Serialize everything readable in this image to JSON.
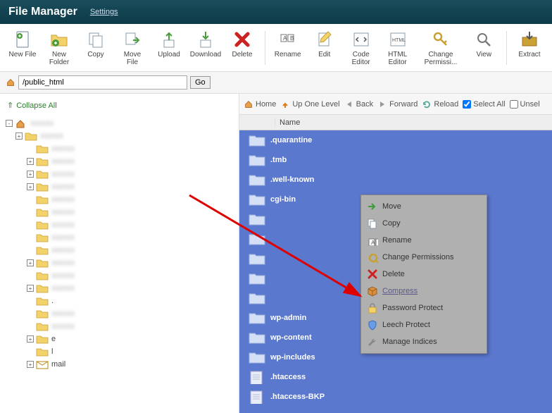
{
  "header": {
    "title": "File Manager",
    "settings": "Settings"
  },
  "toolbar": [
    {
      "key": "new-file",
      "label": "New File"
    },
    {
      "key": "new-folder",
      "label": "New Folder"
    },
    {
      "key": "copy",
      "label": "Copy"
    },
    {
      "key": "move-file",
      "label": "Move File"
    },
    {
      "key": "upload",
      "label": "Upload"
    },
    {
      "key": "download",
      "label": "Download"
    },
    {
      "key": "delete",
      "label": "Delete"
    },
    {
      "key": "sep",
      "label": ""
    },
    {
      "key": "rename",
      "label": "Rename"
    },
    {
      "key": "edit",
      "label": "Edit"
    },
    {
      "key": "code-editor",
      "label": "Code Editor"
    },
    {
      "key": "html-editor",
      "label": "HTML Editor"
    },
    {
      "key": "change-perms",
      "label": "Change Permissi..."
    },
    {
      "key": "view",
      "label": "View"
    },
    {
      "key": "sep",
      "label": ""
    },
    {
      "key": "extract",
      "label": "Extract"
    }
  ],
  "pathbar": {
    "path": "/public_html",
    "go": "Go"
  },
  "collapse_all": "Collapse All",
  "tree": [
    {
      "indent": 0,
      "toggle": "-",
      "label": "",
      "blur": true,
      "home": true
    },
    {
      "indent": 1,
      "toggle": "+",
      "label": "",
      "blur": true
    },
    {
      "indent": 2,
      "toggle": "",
      "label": "",
      "blur": true
    },
    {
      "indent": 2,
      "toggle": "+",
      "label": "",
      "blur": true
    },
    {
      "indent": 2,
      "toggle": "+",
      "label": "",
      "blur": true
    },
    {
      "indent": 2,
      "toggle": "+",
      "label": "",
      "blur": true
    },
    {
      "indent": 2,
      "toggle": "",
      "label": "",
      "blur": true
    },
    {
      "indent": 2,
      "toggle": "",
      "label": "",
      "blur": true
    },
    {
      "indent": 2,
      "toggle": "",
      "label": "",
      "blur": true
    },
    {
      "indent": 2,
      "toggle": "",
      "label": "",
      "blur": true
    },
    {
      "indent": 2,
      "toggle": "",
      "label": "",
      "blur": true
    },
    {
      "indent": 2,
      "toggle": "+",
      "label": "",
      "blur": true
    },
    {
      "indent": 2,
      "toggle": "",
      "label": "",
      "blur": true
    },
    {
      "indent": 2,
      "toggle": "+",
      "label": "",
      "blur": true
    },
    {
      "indent": 2,
      "toggle": "",
      "label": ".",
      "blur": false
    },
    {
      "indent": 2,
      "toggle": "",
      "label": "",
      "blur": true
    },
    {
      "indent": 2,
      "toggle": "",
      "label": "",
      "blur": true
    },
    {
      "indent": 2,
      "toggle": "+",
      "label": "e",
      "blur": false
    },
    {
      "indent": 2,
      "toggle": "",
      "label": "l",
      "blur": false
    },
    {
      "indent": 2,
      "toggle": "+",
      "label": "mail",
      "blur": false,
      "mail": true
    }
  ],
  "nav2": {
    "home": "Home",
    "up": "Up One Level",
    "back": "Back",
    "forward": "Forward",
    "reload": "Reload",
    "select_all": "Select All",
    "unselect": "Unsel"
  },
  "list_header": {
    "name": "Name"
  },
  "files": [
    {
      "name": ".quarantine",
      "type": "folder"
    },
    {
      "name": ".tmb",
      "type": "folder"
    },
    {
      "name": ".well-known",
      "type": "folder"
    },
    {
      "name": "cgi-bin",
      "type": "folder"
    },
    {
      "name": "",
      "type": "folder"
    },
    {
      "name": "",
      "type": "folder"
    },
    {
      "name": "",
      "type": "folder"
    },
    {
      "name": "",
      "type": "folder"
    },
    {
      "name": "",
      "type": "folder"
    },
    {
      "name": "wp-admin",
      "type": "folder"
    },
    {
      "name": "wp-content",
      "type": "folder"
    },
    {
      "name": "wp-includes",
      "type": "folder"
    },
    {
      "name": ".htaccess",
      "type": "file"
    },
    {
      "name": ".htaccess-BKP",
      "type": "file"
    }
  ],
  "context_menu": [
    {
      "key": "move",
      "label": "Move"
    },
    {
      "key": "copy",
      "label": "Copy"
    },
    {
      "key": "rename",
      "label": "Rename"
    },
    {
      "key": "perms",
      "label": "Change Permissions"
    },
    {
      "key": "delete",
      "label": "Delete"
    },
    {
      "key": "compress",
      "label": "Compress",
      "highlight": true
    },
    {
      "key": "password",
      "label": "Password Protect"
    },
    {
      "key": "leech",
      "label": "Leech Protect"
    },
    {
      "key": "indices",
      "label": "Manage Indices"
    }
  ]
}
